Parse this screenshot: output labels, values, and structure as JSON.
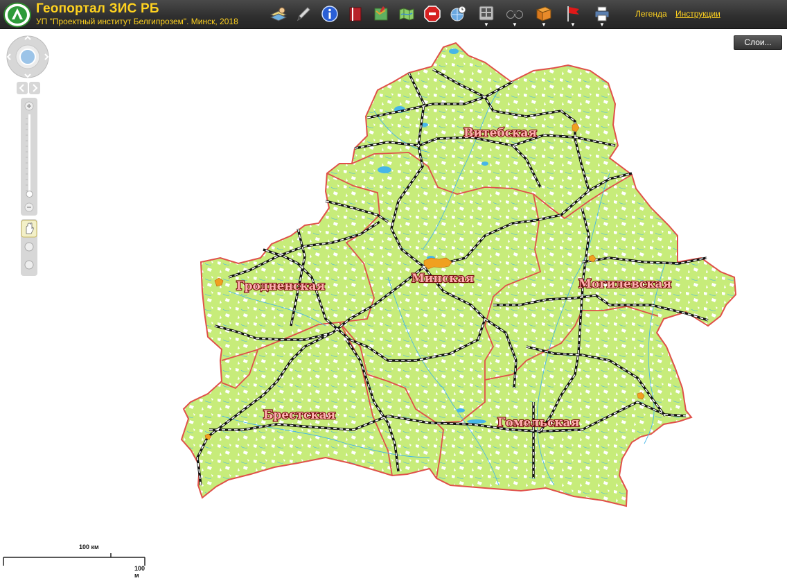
{
  "header": {
    "title": "Геопортал ЗИС РБ",
    "subtitle": "УП \"Проектный институт Белгипрозем\". Минск, 2018",
    "toolbar": [
      {
        "icon": "layers-hand-icon"
      },
      {
        "icon": "pencil-icon"
      },
      {
        "icon": "info-icon"
      },
      {
        "icon": "book-icon"
      },
      {
        "icon": "map-edit-icon"
      },
      {
        "icon": "map-icon"
      },
      {
        "icon": "stop-icon"
      },
      {
        "icon": "globe-clock-icon"
      },
      {
        "icon": "calculator-icon",
        "dropdown": "▼"
      },
      {
        "icon": "binoculars-icon",
        "dropdown": "▼"
      },
      {
        "icon": "bookmark-book-icon",
        "dropdown": "▼"
      },
      {
        "icon": "flag-icon",
        "dropdown": "▼"
      },
      {
        "icon": "printer-icon",
        "dropdown": "▼"
      }
    ],
    "legend_link": "Легенда",
    "instructions_link": "Инструкции"
  },
  "layers_button": "Слои...",
  "map": {
    "regions": [
      {
        "name": "Витебская"
      },
      {
        "name": "Гродненская"
      },
      {
        "name": "Минская"
      },
      {
        "name": "Могилевская"
      },
      {
        "name": "Брестская"
      },
      {
        "name": "Гомельская"
      }
    ],
    "colors": {
      "land": "#c7ec7a",
      "forest_white": "#ffffff",
      "border": "#e0504a",
      "rail": "#111111",
      "water": "#46b6e8",
      "city": "#f0a020"
    }
  },
  "scalebar": {
    "top_label": "100 км",
    "bottom_label": "100 м"
  }
}
